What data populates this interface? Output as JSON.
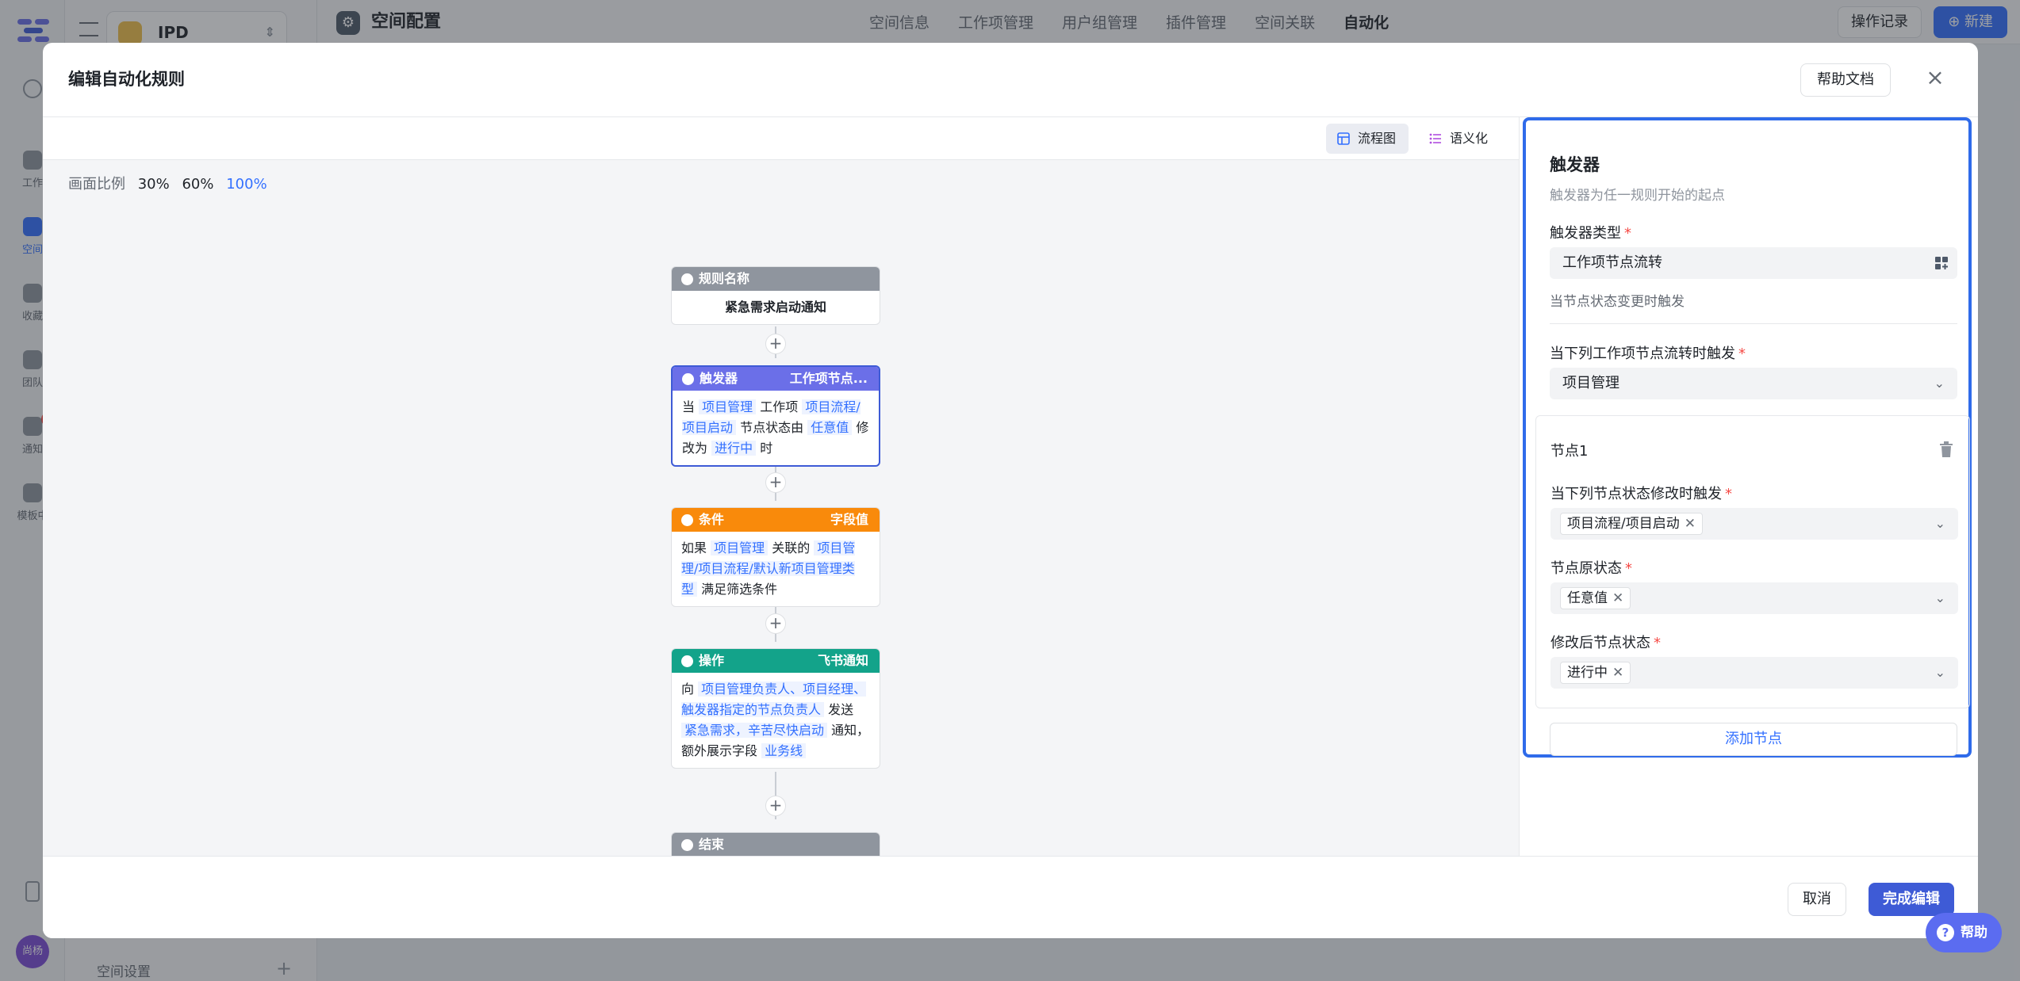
{
  "background": {
    "app_nav": [
      {
        "label": "工作",
        "icon": "home-icon"
      },
      {
        "label": "空间",
        "icon": "space-icon",
        "active": true
      },
      {
        "label": "收藏",
        "icon": "star-icon"
      },
      {
        "label": "团队",
        "icon": "team-icon"
      },
      {
        "label": "通知",
        "icon": "bell-icon"
      },
      {
        "label": "模板中",
        "icon": "template-icon"
      }
    ],
    "avatar": "尚杨",
    "project_name": "IPD",
    "space_settings": "空间设置",
    "page_title": "空间配置",
    "tabs": [
      "空间信息",
      "工作项管理",
      "用户组管理",
      "插件管理",
      "空间关联",
      "自动化"
    ],
    "active_tab": "自动化",
    "oplog": "操作记录",
    "new": "新建"
  },
  "modal": {
    "title": "编辑自动化规则",
    "help_doc": "帮助文档",
    "view_modes": [
      "流程图",
      "语义化"
    ],
    "zoom_label": "画面比例",
    "zoom_levels": [
      "30%",
      "60%",
      "100%"
    ],
    "flow": {
      "rule": {
        "head": "规则名称",
        "body": "紧急需求启动通知"
      },
      "trigger": {
        "head": "触发器",
        "sub": "工作项节点...",
        "t1": "当",
        "v1": "项目管理",
        "t2": "工作项",
        "v2": "项目流程/项目启动",
        "t3": "节点状态由",
        "v3": "任意值",
        "t4": "修改为",
        "v4": "进行中",
        "t5": "时"
      },
      "condition": {
        "head": "条件",
        "sub": "字段值",
        "t1": "如果",
        "v1": "项目管理",
        "t2": "关联的",
        "v2": "项目管理/项目流程/默认新项目管理类型",
        "t3": "满足筛选条件"
      },
      "action": {
        "head": "操作",
        "sub": "飞书通知",
        "t1": "向",
        "v1": "项目管理负责人、项目经理、触发器指定的节点负责人",
        "t2": "发送",
        "v2": "紧急需求，辛苦尽快启动",
        "t3": "通知，额外展示字段",
        "v3": "业务线"
      },
      "end": {
        "head": "结束"
      }
    },
    "panel": {
      "title": "触发器",
      "desc": "触发器为任一规则开始的起点",
      "type_label": "触发器类型",
      "type_value": "工作项节点流转",
      "type_hint": "当节点状态变更时触发",
      "workitem_label": "当下列工作项节点流转时触发",
      "workitem_value": "项目管理",
      "node_title": "节点1",
      "node_status_label": "当下列节点状态修改时触发",
      "node_status_chip": "项目流程/项目启动",
      "from_label": "节点原状态",
      "from_chip": "任意值",
      "to_label": "修改后节点状态",
      "to_chip": "进行中",
      "add_node": "添加节点"
    },
    "cancel": "取消",
    "done": "完成编辑"
  },
  "help_float": "帮助",
  "colors": {
    "accent": "#3370ff",
    "trigger": "#6b6fe8",
    "condition": "#f98a0b",
    "action": "#13a38a",
    "gray": "#8f959e"
  }
}
